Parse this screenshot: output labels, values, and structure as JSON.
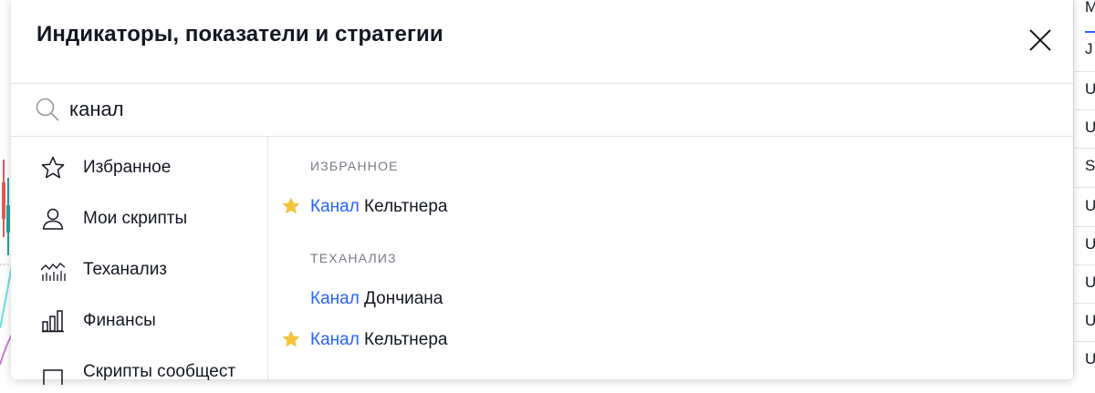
{
  "dialog": {
    "title": "Индикаторы, показатели и стратегии",
    "close_icon": "close-icon"
  },
  "search": {
    "value": "канал",
    "icon": "search-icon"
  },
  "sidebar": {
    "items": [
      {
        "label": "Избранное",
        "icon": "star-outline-icon"
      },
      {
        "label": "Мои скрипты",
        "icon": "user-icon"
      },
      {
        "label": "Теханализ",
        "icon": "technical-analysis-icon"
      },
      {
        "label": "Финансы",
        "icon": "bar-chart-icon"
      },
      {
        "label": "Скрипты сообщест",
        "icon": "community-scripts-icon"
      }
    ]
  },
  "results": {
    "sections": [
      {
        "header": "ИЗБРАННОЕ",
        "items": [
          {
            "highlight": "Канал",
            "rest": " Кельтнера",
            "favorite": true
          }
        ]
      },
      {
        "header": "ТЕХАНАЛИЗ",
        "items": [
          {
            "highlight": "Канал",
            "rest": " Дончиана",
            "favorite": false
          },
          {
            "highlight": "Канал",
            "rest": " Кельтнера",
            "favorite": true
          }
        ]
      }
    ]
  },
  "background_right": {
    "cells": [
      "M",
      "J",
      "U",
      "U",
      "SI",
      "U",
      "U",
      "U",
      "U",
      "U"
    ]
  },
  "colors": {
    "accent": "#2962ff",
    "star": "#f7c33a",
    "text": "#131722",
    "muted": "#787b86",
    "border": "#e0e3eb"
  }
}
